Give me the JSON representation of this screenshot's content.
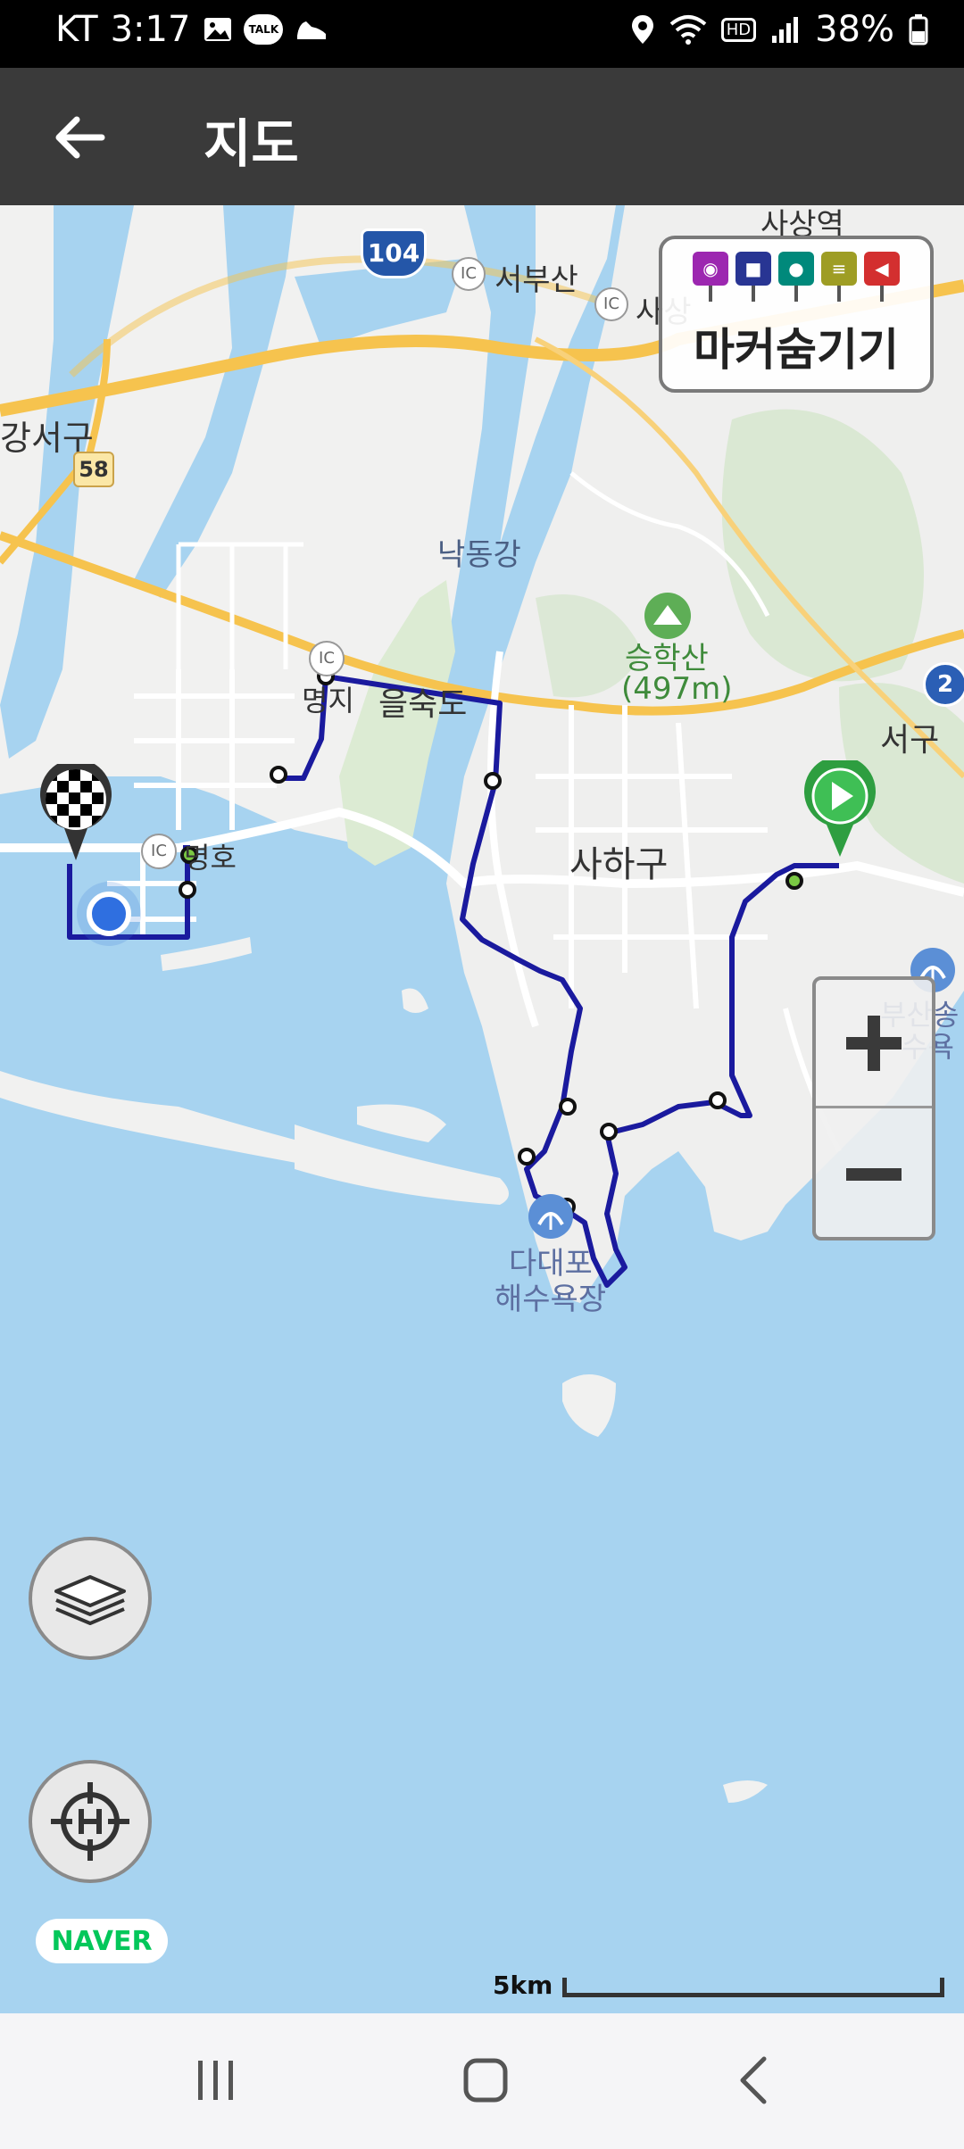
{
  "status_bar": {
    "carrier": "KT",
    "time": "3:17",
    "talk_badge": "TALK",
    "hd_badge": "HD",
    "battery": "38%"
  },
  "app_bar": {
    "title": "지도",
    "back_icon": "arrow-left-icon"
  },
  "map": {
    "labels": {
      "sasang_station": "사상역",
      "seobusan_ic": "서부산",
      "sasang_ic": "사상",
      "ic_badge": "IC",
      "route_104": "104",
      "gangseo": "강서구",
      "route_58": "58",
      "nakdonggang": "낙동강",
      "seunghaksan": "승학산",
      "seunghaksan_height": "(497m)",
      "myeongji": "명지",
      "eulsukdo": "을숙도",
      "myeongho": "명호",
      "saha": "사하구",
      "seogu": "서구",
      "route_2": "2",
      "busan_beach": "부산송",
      "beach_suffix": "수욕",
      "dadaepo_line1": "다대포",
      "dadaepo_line2": "해수욕장"
    },
    "marker_panel": {
      "label": "마커숨기기",
      "marker_icons": [
        "camera-icon",
        "video-icon",
        "microphone-icon",
        "memo-icon",
        "flag-icon"
      ],
      "marker_colors": [
        "#9c27b0",
        "#283593",
        "#00897b",
        "#9e9d24",
        "#d32f2f"
      ]
    },
    "zoom": {
      "in_icon": "plus-icon",
      "out_icon": "minus-icon"
    },
    "buttons": {
      "layers_icon": "layers-icon",
      "home_icon": "home-target-icon"
    },
    "logo": "NAVER",
    "scale": "5km",
    "route_color": "#1a1a9e",
    "start_marker_color": "#2e9e40"
  },
  "nav_bar": {
    "recents_icon": "recents-icon",
    "home_icon": "home-icon",
    "back_icon": "back-chevron-icon"
  }
}
